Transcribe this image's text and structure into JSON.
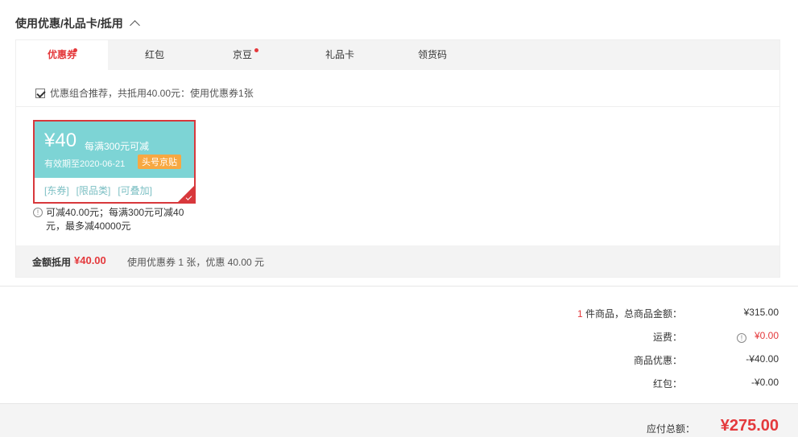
{
  "section": {
    "title": "使用优惠/礼品卡/抵用"
  },
  "tabs": [
    {
      "label": "优惠券",
      "active": true,
      "dot": true
    },
    {
      "label": "红包",
      "active": false,
      "dot": false
    },
    {
      "label": "京豆",
      "active": false,
      "dot": true
    },
    {
      "label": "礼品卡",
      "active": false,
      "dot": false
    },
    {
      "label": "领货码",
      "active": false,
      "dot": false
    }
  ],
  "combo": {
    "checked": true,
    "text": "优惠组合推荐，共抵用40.00元：使用优惠券1张"
  },
  "coupon": {
    "amount": "¥40",
    "condition": "每满300元可减",
    "valid": "有效期至2020-06-21",
    "badge": "头号京贴",
    "tags": [
      "[东券]",
      "[限品类]",
      "[可叠加]"
    ],
    "selected": true
  },
  "coupon_note": "可减40.00元；每满300元可减40元，最多减40000元",
  "discount_bar": {
    "label": "金额抵用",
    "amount": "¥40.00",
    "desc": "使用优惠券 1 张，优惠 40.00 元"
  },
  "summary": {
    "items_count": "1",
    "items_label": " 件商品，总商品金额：",
    "items_total": "¥315.00",
    "shipping_label": "运费：",
    "shipping_value": "¥0.00",
    "product_discount_label": "商品优惠：",
    "product_discount_value": "-¥40.00",
    "redpacket_label": "红包：",
    "redpacket_value": "-¥0.00",
    "total_label": "应付总额：",
    "total_value": "¥275.00"
  },
  "colors": {
    "accent": "#e4393c",
    "coupon_bg": "#7dd4d5",
    "badge": "#f7a842",
    "tag": "#7bbfc3"
  }
}
